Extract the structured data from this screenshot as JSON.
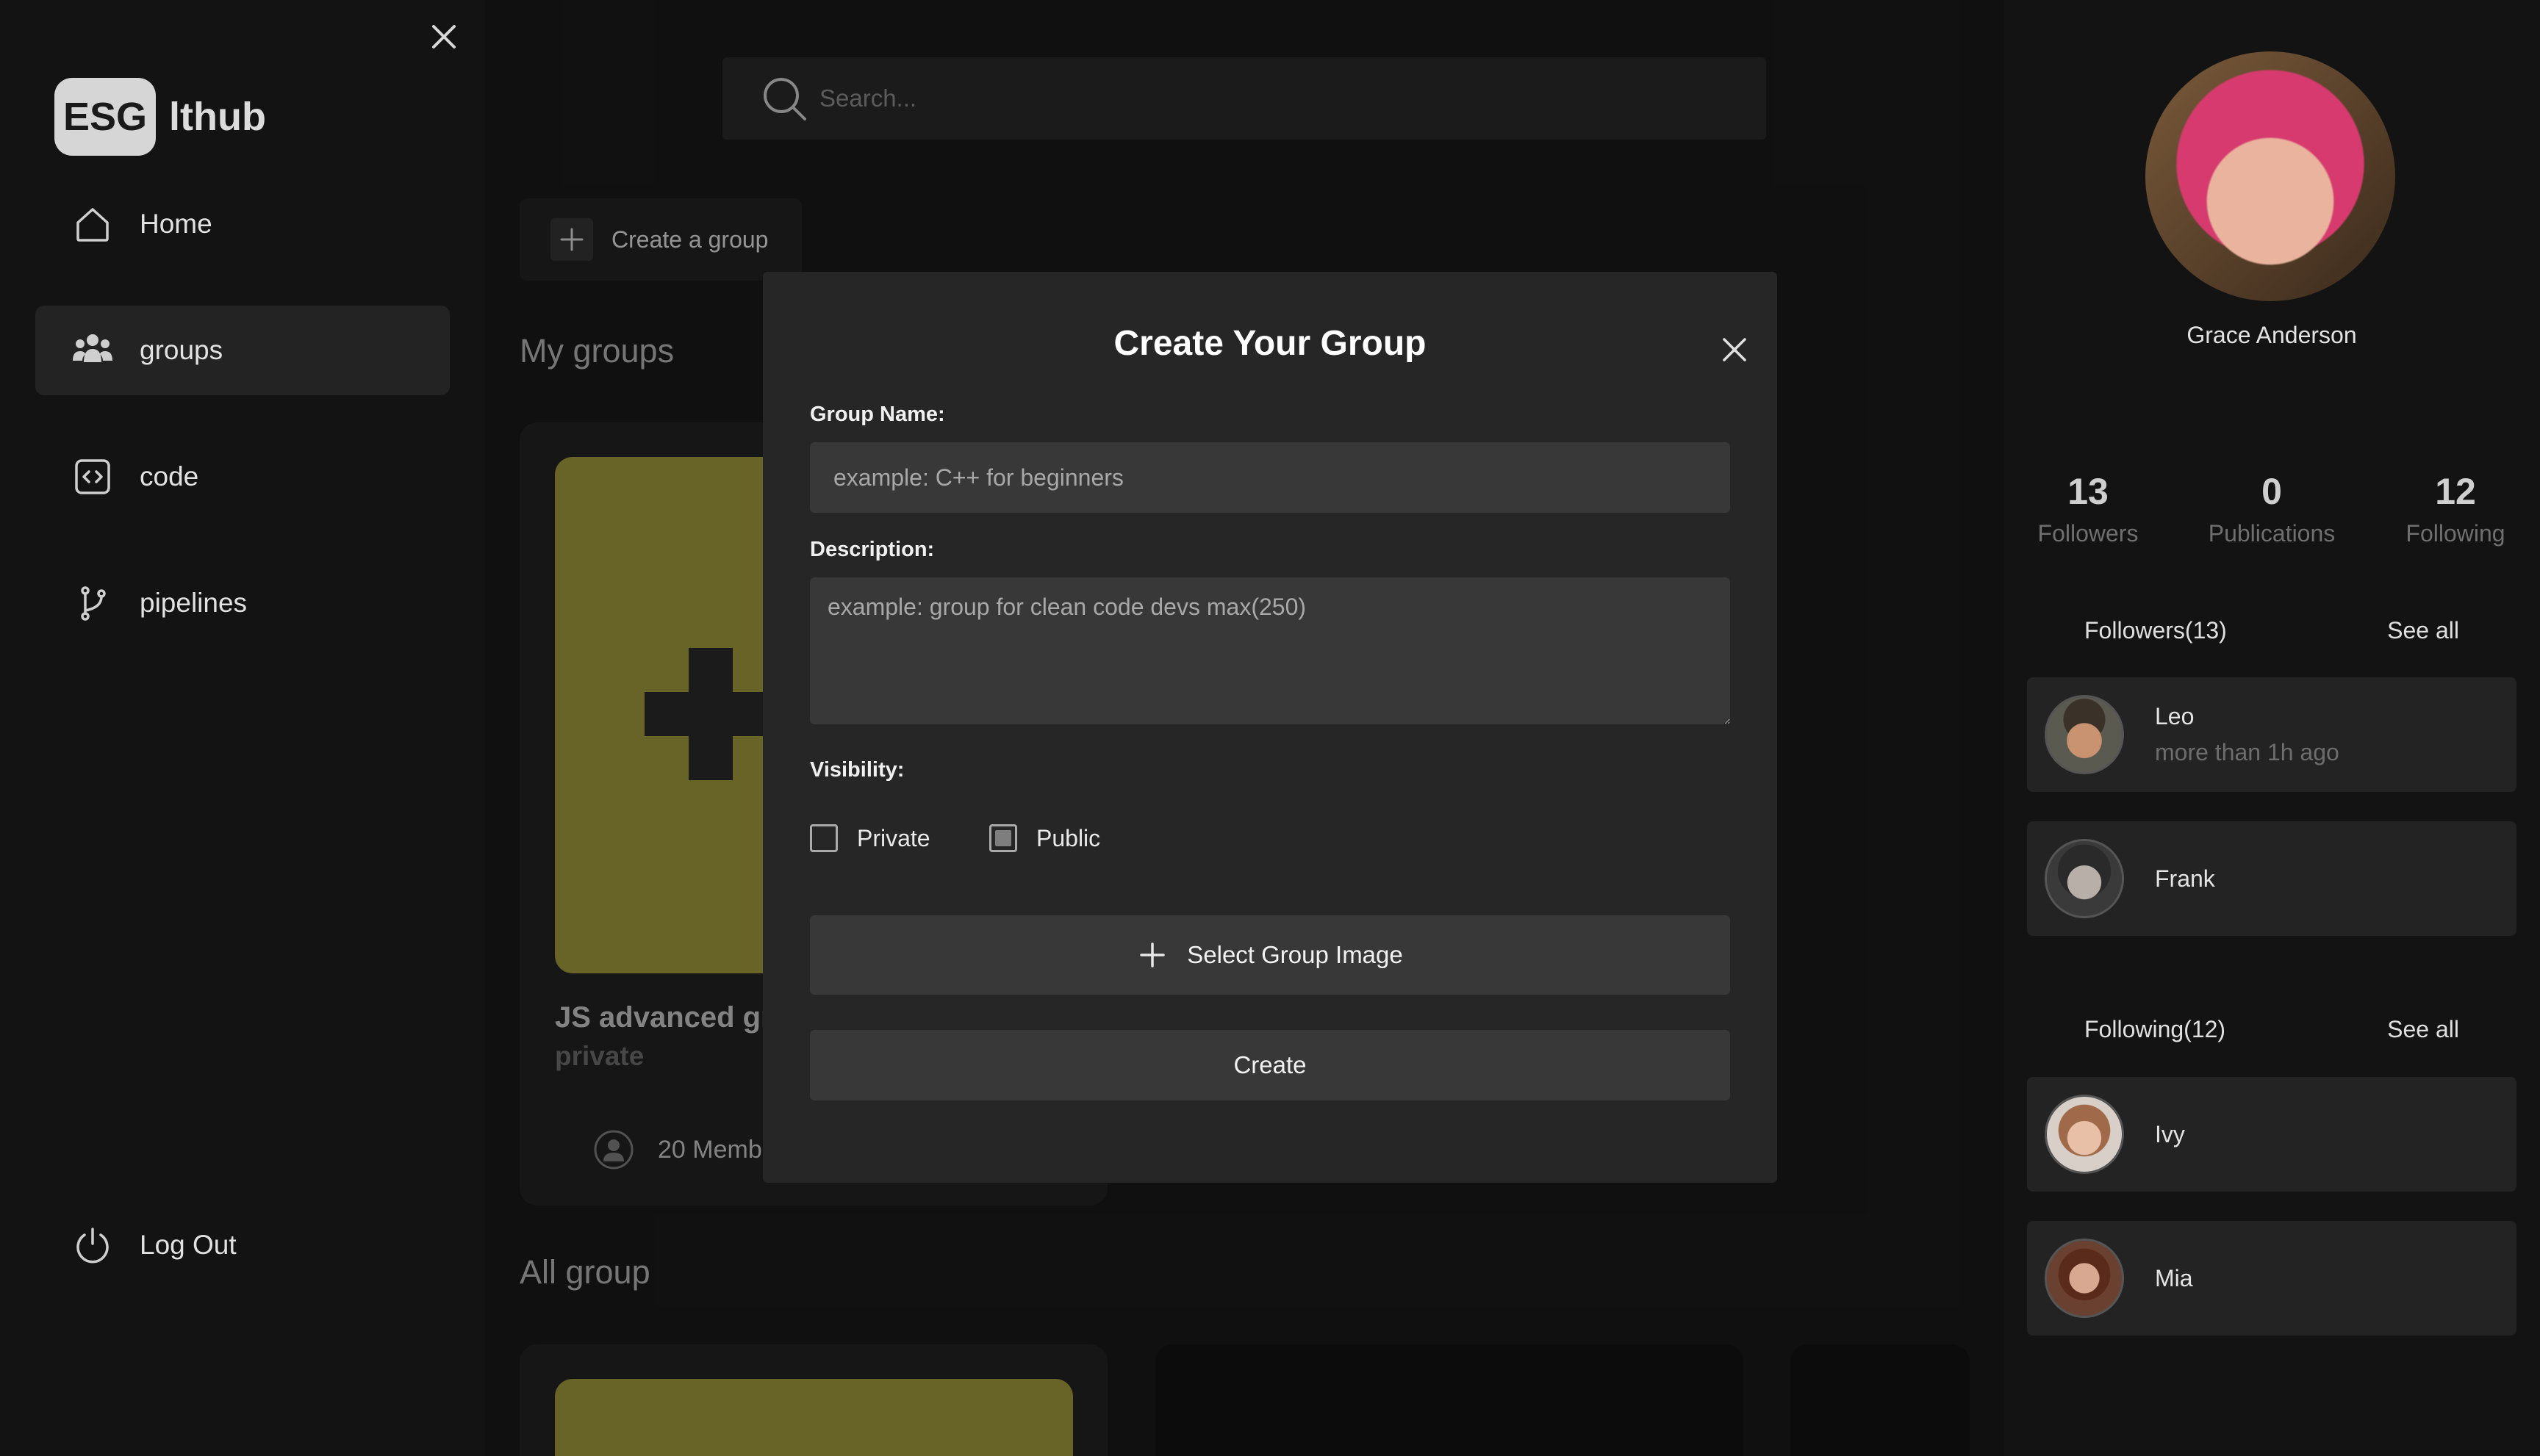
{
  "app": {
    "logo_badge": "ESG",
    "logo_text": "lthub"
  },
  "sidebar": {
    "items": [
      {
        "label": "Home",
        "icon": "home-icon"
      },
      {
        "label": "groups",
        "icon": "users-icon",
        "active": true
      },
      {
        "label": "code",
        "icon": "code-icon"
      },
      {
        "label": "pipelines",
        "icon": "git-branch-icon"
      }
    ],
    "logout_label": "Log Out"
  },
  "search": {
    "placeholder": "Search..."
  },
  "main": {
    "create_group_label": "Create a group",
    "my_groups_title": "My groups",
    "all_group_title": "All group",
    "group_card": {
      "title": "JS advanced gr",
      "visibility": "private",
      "members": "20 Memb"
    }
  },
  "modal": {
    "title": "Create Your Group",
    "group_name_label": "Group Name:",
    "group_name_placeholder": "example: C++ for beginners",
    "description_label": "Description:",
    "description_placeholder": "example: group for clean code devs max(250)",
    "visibility_label": "Visibility:",
    "visibility_options": [
      {
        "label": "Private",
        "checked": false
      },
      {
        "label": "Public",
        "checked": true
      }
    ],
    "select_image_label": "Select Group Image",
    "create_label": "Create"
  },
  "profile": {
    "name": "Grace Anderson",
    "stats": [
      {
        "value": "13",
        "label": "Followers"
      },
      {
        "value": "0",
        "label": "Publications"
      },
      {
        "value": "12",
        "label": "Following"
      }
    ],
    "followers_title": "Followers(13)",
    "following_title": "Following(12)",
    "see_all_label": "See all",
    "followers": [
      {
        "name": "Leo",
        "sub": "more than 1h ago"
      },
      {
        "name": "Frank",
        "sub": ""
      }
    ],
    "following": [
      {
        "name": "Ivy",
        "sub": ""
      },
      {
        "name": "Mia",
        "sub": ""
      }
    ]
  }
}
